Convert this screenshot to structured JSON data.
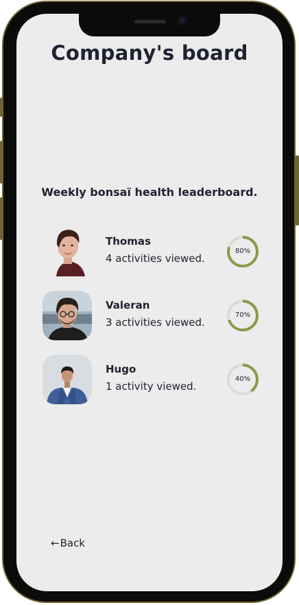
{
  "page": {
    "title": "Company's board",
    "subtitle": "Weekly bonsaï health leaderboard."
  },
  "colors": {
    "accent": "#8a9a4b",
    "track": "#dcdcd6",
    "screen_bg": "#ececec",
    "text": "#1f2230",
    "frame": "#6f6430"
  },
  "leaderboard": [
    {
      "name": "Thomas",
      "activity": "4 activities viewed.",
      "percent_label": "80%",
      "progress": 0.8
    },
    {
      "name": "Valeran",
      "activity": "3 activities viewed.",
      "percent_label": "70%",
      "progress": 0.7
    },
    {
      "name": "Hugo",
      "activity": "1 activity viewed.",
      "percent_label": "40%",
      "progress": 0.4
    }
  ],
  "back": {
    "icon": "arrow-left-icon",
    "label": "Back"
  }
}
